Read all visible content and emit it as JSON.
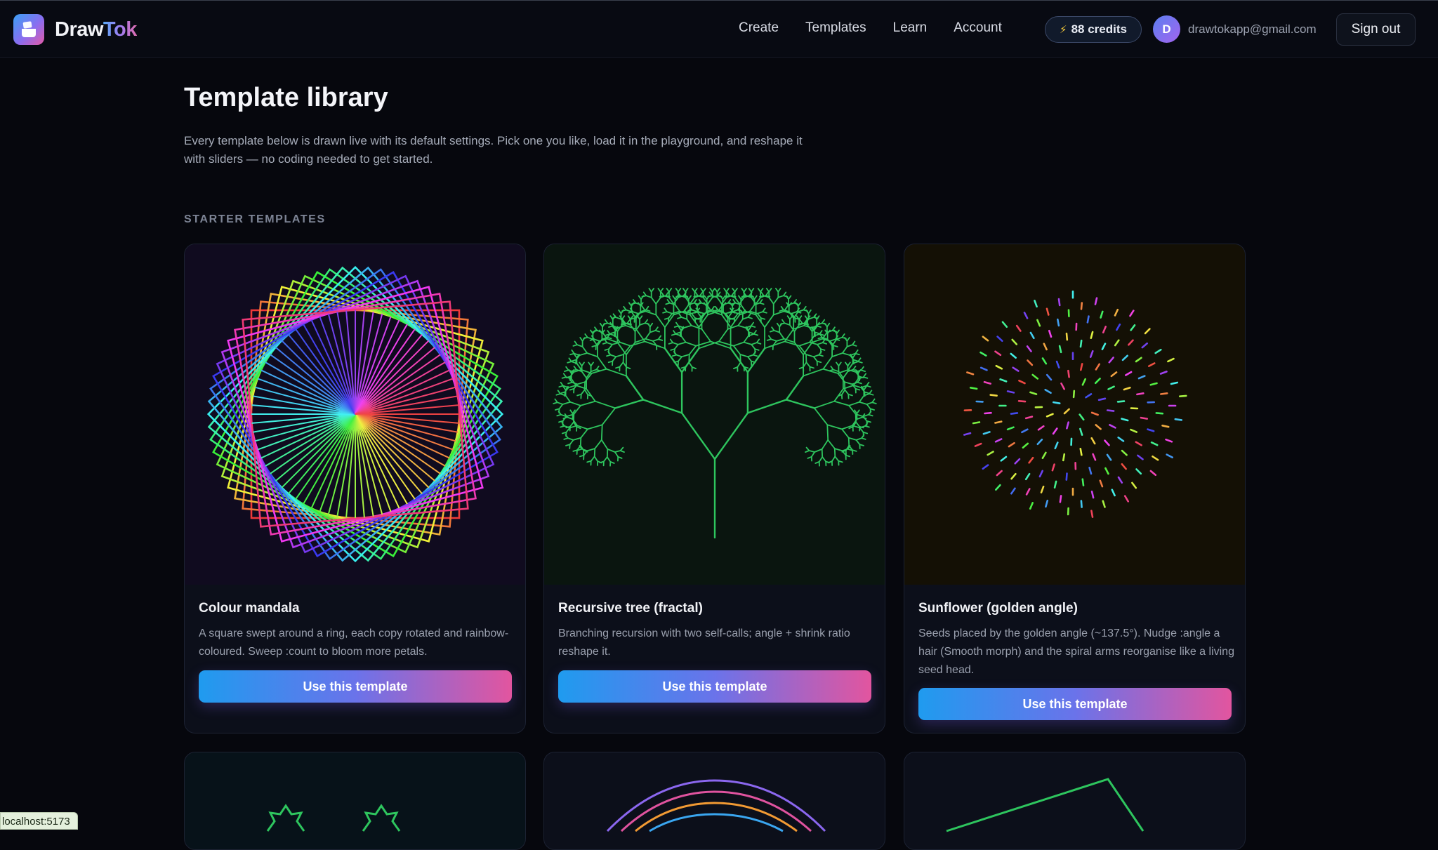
{
  "brand": {
    "name_part1": "Draw",
    "name_part2": "Tok"
  },
  "nav": {
    "items": [
      "Create",
      "Templates",
      "Learn",
      "Account"
    ]
  },
  "user": {
    "credits_label": "88 credits",
    "avatar_initial": "D",
    "email": "drawtokapp@gmail.com",
    "signout_label": "Sign out"
  },
  "page": {
    "title": "Template library",
    "intro": "Every template below is drawn live with its default settings. Pick one you like, load it in the playground, and reshape it with sliders — no coding needed to get started.",
    "section_label": "STARTER TEMPLATES"
  },
  "cards": [
    {
      "title": "Colour mandala",
      "description": "A square swept around a ring, each copy rotated and rainbow-coloured. Sweep :count to bloom more petals.",
      "button_label": "Use this template",
      "art_bg": "#100b1f"
    },
    {
      "title": "Recursive tree (fractal)",
      "description": "Branching recursion with two self-calls; angle + shrink ratio reshape it.",
      "button_label": "Use this template",
      "art_bg": "#0a150f"
    },
    {
      "title": "Sunflower (golden angle)",
      "description": "Seeds placed by the golden angle (~137.5°). Nudge :angle a hair (Smooth morph) and the spiral arms reorganise like a living seed head.",
      "button_label": "Use this template",
      "art_bg": "#141005"
    }
  ],
  "status_bar": {
    "url": "localhost:5173"
  },
  "colors": {
    "accent_start": "#1f9bef",
    "accent_end": "#e2559f",
    "tree": "#2ec55e",
    "background": "#06070d"
  }
}
